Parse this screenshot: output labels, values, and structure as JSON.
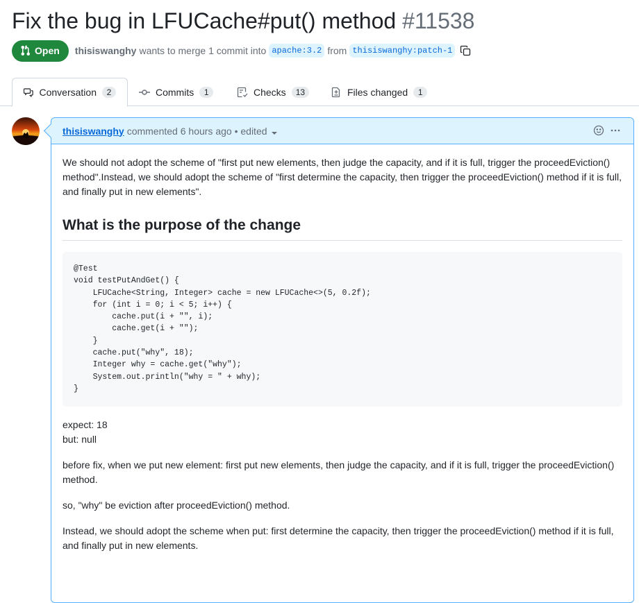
{
  "pr": {
    "title": "Fix the bug in LFUCache#put() method",
    "number": "#11538",
    "state": "Open",
    "author": "thisiswanghy",
    "merge_text": "wants to merge 1 commit into",
    "base_branch": "apache:3.2",
    "from_text": "from",
    "head_branch": "thisiswanghy:patch-1"
  },
  "tabs": [
    {
      "label": "Conversation",
      "count": "2",
      "icon": "comment-discussion-icon"
    },
    {
      "label": "Commits",
      "count": "1",
      "icon": "git-commit-icon"
    },
    {
      "label": "Checks",
      "count": "13",
      "icon": "checklist-icon"
    },
    {
      "label": "Files changed",
      "count": "1",
      "icon": "file-diff-icon"
    }
  ],
  "comment": {
    "author": "thisiswanghy",
    "action": "commented",
    "time": "6 hours ago",
    "edited": "• edited",
    "para1": "We should not adopt the scheme of \"first put new elements, then judge the capacity, and if it is full, trigger the proceedEviction() method\".Instead, we should adopt the scheme of \"first determine the capacity, then trigger the proceedEviction() method if it is full, and finally put in new elements\".",
    "heading": "What is the purpose of the change",
    "code": "@Test\nvoid testPutAndGet() {\n    LFUCache<String, Integer> cache = new LFUCache<>(5, 0.2f);\n    for (int i = 0; i < 5; i++) {\n        cache.put(i + \"\", i);\n        cache.get(i + \"\");\n    }\n    cache.put(\"why\", 18);\n    Integer why = cache.get(\"why\");\n    System.out.println(\"why = \" + why);\n}",
    "expect": "expect: 18",
    "but": "but: null",
    "para2": "before fix, when we put new element: first put new elements, then judge the capacity, and if it is full, trigger the proceedEviction() method.",
    "para3": "so, \"why\" be eviction after proceedEviction() method.",
    "para4": "Instead, we should adopt the scheme when put: first determine the capacity, then trigger the proceedEviction() method if it is full, and finally put in new elements."
  },
  "colors": {
    "open_badge": "#1f883d",
    "link": "#0969da",
    "header_bg": "#ddf4ff"
  }
}
